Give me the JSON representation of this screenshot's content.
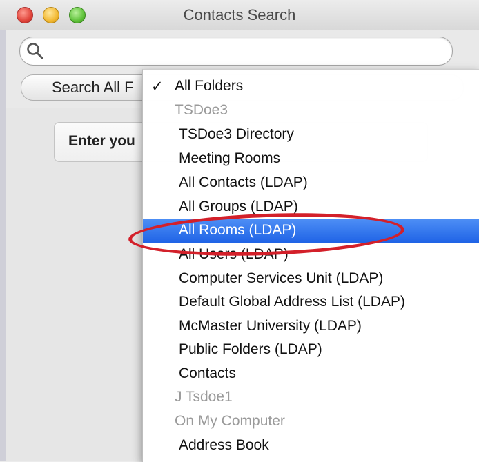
{
  "window": {
    "title": "Contacts Search"
  },
  "search": {
    "placeholder": "",
    "value": ""
  },
  "scope_button": {
    "label": "Search All F"
  },
  "prompt": {
    "text": "Enter you"
  },
  "menu": {
    "items": [
      {
        "label": "All Folders",
        "checked": true,
        "enabled": true
      },
      {
        "label": "TSDoe3",
        "enabled": false,
        "header": true
      },
      {
        "label": "TSDoe3 Directory",
        "enabled": true
      },
      {
        "label": "Meeting Rooms",
        "enabled": true
      },
      {
        "label": "All Contacts  (LDAP)",
        "enabled": true
      },
      {
        "label": "All Groups  (LDAP)",
        "enabled": true
      },
      {
        "label": "All Rooms  (LDAP)",
        "enabled": true,
        "highlighted": true
      },
      {
        "label": "All Users  (LDAP)",
        "enabled": true
      },
      {
        "label": "Computer Services Unit  (LDAP)",
        "enabled": true
      },
      {
        "label": "Default Global Address List  (LDAP)",
        "enabled": true
      },
      {
        "label": "McMaster University  (LDAP)",
        "enabled": true
      },
      {
        "label": "Public Folders  (LDAP)",
        "enabled": true
      },
      {
        "label": "Contacts",
        "enabled": true
      },
      {
        "label": "J Tsdoe1",
        "enabled": false,
        "header": true
      },
      {
        "label": "On My Computer",
        "enabled": false,
        "header": true
      },
      {
        "label": "Address Book",
        "enabled": true
      }
    ],
    "check_glyph": "✓"
  },
  "colors": {
    "selection": "#2a6ff0",
    "annotation_ring": "#d3202a"
  },
  "icons": {
    "search": "search-icon"
  }
}
